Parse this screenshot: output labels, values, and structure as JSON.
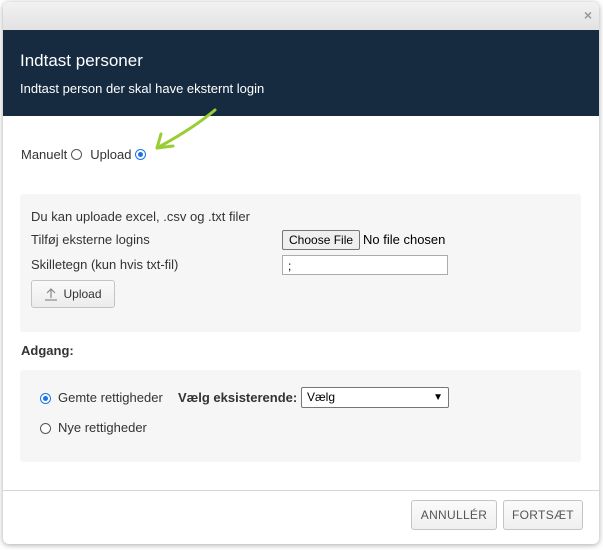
{
  "dialog": {
    "close_glyph": "×",
    "title": "Indtast personer",
    "subtitle": "Indtast person der skal have eksternt login"
  },
  "mode": {
    "manual_label": "Manuelt",
    "upload_label": "Upload",
    "selected": "upload",
    "arrow_color": "#9acd32"
  },
  "upload": {
    "info": "Du kan uploade excel, .csv og .txt filer",
    "add_label": "Tilføj eksterne logins",
    "choose_file_label": "Choose File",
    "no_file_text": "No file chosen",
    "separator_label": "Skilletegn (kun hvis txt-fil)",
    "separator_value": ";",
    "upload_button": "Upload"
  },
  "access": {
    "heading": "Adgang:",
    "saved_rights_label": "Gemte rettigheder",
    "choose_existing_label": "Vælg eksisterende:",
    "select_value": "Vælg",
    "new_rights_label": "Nye rettigheder",
    "selected": "saved"
  },
  "footer": {
    "cancel": "ANNULLÉR",
    "continue": "FORTSÆT"
  },
  "colors": {
    "header_bg": "#162a40",
    "radio_accent": "#1a73e8"
  }
}
